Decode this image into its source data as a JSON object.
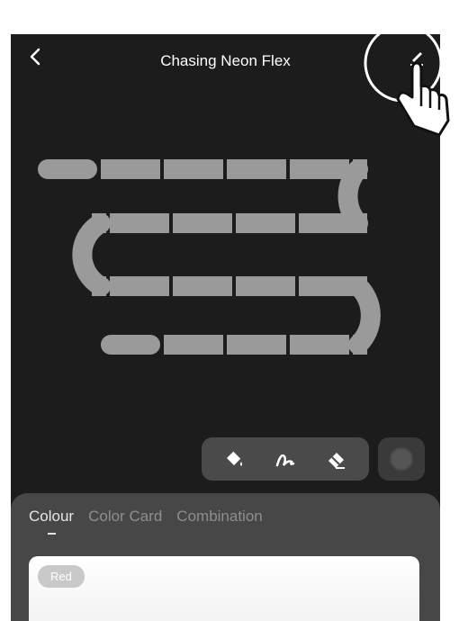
{
  "header": {
    "title": "Chasing Neon Flex",
    "back_icon": "chevron-left-icon",
    "edit_icon": "pencil-icon"
  },
  "toolbar": {
    "tools": [
      {
        "name": "fill",
        "icon": "paint-bucket-icon"
      },
      {
        "name": "draw",
        "icon": "brush-icon"
      },
      {
        "name": "erase",
        "icon": "eraser-icon"
      }
    ],
    "record_icon": "record-icon"
  },
  "panel": {
    "tabs": [
      {
        "label": "Colour",
        "active": true
      },
      {
        "label": "Color Card",
        "active": false
      },
      {
        "label": "Combination",
        "active": false
      }
    ],
    "selected_color_label": "Red"
  },
  "colors": {
    "background": "#1c1c1c",
    "segment": "#9a9a9a",
    "panel": "#474747"
  }
}
